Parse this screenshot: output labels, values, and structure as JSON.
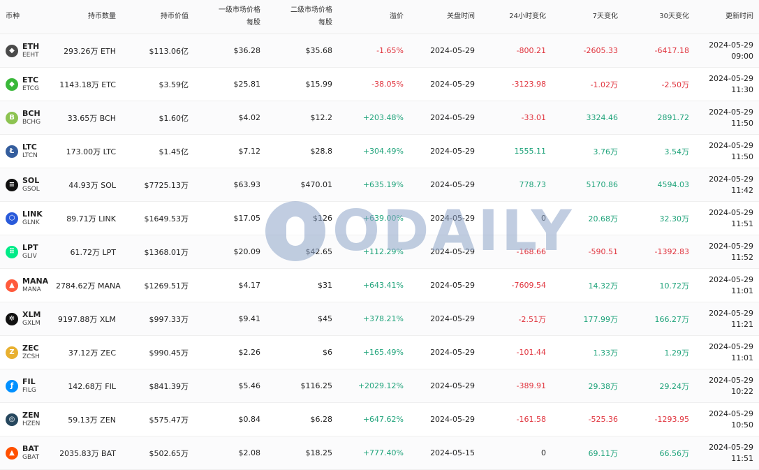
{
  "headers": {
    "coin": "币种",
    "holdings": "持币数量",
    "holdings_value": "持币价值",
    "primary_price_l1": "一级市场价格",
    "primary_price_l2": "每股",
    "secondary_price_l1": "二级市场价格",
    "secondary_price_l2": "每股",
    "premium": "溢价",
    "close_time": "关盘时间",
    "change_24h": "24小时变化",
    "change_7d": "7天变化",
    "change_30d": "30天变化",
    "updated": "更新时间"
  },
  "colors": {
    "positive": "#1fa37a",
    "negative": "#e0333d"
  },
  "watermark": "ODAILY",
  "rows": [
    {
      "symbol": "ETH",
      "fund": "EEHT",
      "icon": "ethereum-icon",
      "icon_glyph": "◆",
      "icon_color": "#4a4a4a",
      "holdings": "293.26万 ETH",
      "value": "$113.06亿",
      "primary": "$36.28",
      "secondary": "$35.68",
      "premium": "-1.65%",
      "premium_s": "neg",
      "close": "2024-05-29",
      "c24": "-800.21",
      "c24_s": "neg",
      "c7": "-2605.33",
      "c7_s": "neg",
      "c30": "-6417.18",
      "c30_s": "neg",
      "upd_date": "2024-05-29",
      "upd_time": "09:00"
    },
    {
      "symbol": "ETC",
      "fund": "ETCG",
      "icon": "ethereum-classic-icon",
      "icon_glyph": "◆",
      "icon_color": "#3ab83a",
      "holdings": "1143.18万 ETC",
      "value": "$3.59亿",
      "primary": "$25.81",
      "secondary": "$15.99",
      "premium": "-38.05%",
      "premium_s": "neg",
      "close": "2024-05-29",
      "c24": "-3123.98",
      "c24_s": "neg",
      "c7": "-1.02万",
      "c7_s": "neg",
      "c30": "-2.50万",
      "c30_s": "neg",
      "upd_date": "2024-05-29",
      "upd_time": "11:30"
    },
    {
      "symbol": "BCH",
      "fund": "BCHG",
      "icon": "bitcoin-cash-icon",
      "icon_glyph": "B",
      "icon_color": "#8dc351",
      "holdings": "33.65万 BCH",
      "value": "$1.60亿",
      "primary": "$4.02",
      "secondary": "$12.2",
      "premium": "+203.48%",
      "premium_s": "pos",
      "close": "2024-05-29",
      "c24": "-33.01",
      "c24_s": "neg",
      "c7": "3324.46",
      "c7_s": "pos",
      "c30": "2891.72",
      "c30_s": "pos",
      "upd_date": "2024-05-29",
      "upd_time": "11:50"
    },
    {
      "symbol": "LTC",
      "fund": "LTCN",
      "icon": "litecoin-icon",
      "icon_glyph": "Ł",
      "icon_color": "#345d9d",
      "holdings": "173.00万 LTC",
      "value": "$1.45亿",
      "primary": "$7.12",
      "secondary": "$28.8",
      "premium": "+304.49%",
      "premium_s": "pos",
      "close": "2024-05-29",
      "c24": "1555.11",
      "c24_s": "pos",
      "c7": "3.76万",
      "c7_s": "pos",
      "c30": "3.54万",
      "c30_s": "pos",
      "upd_date": "2024-05-29",
      "upd_time": "11:50"
    },
    {
      "symbol": "SOL",
      "fund": "GSOL",
      "icon": "solana-icon",
      "icon_glyph": "≡",
      "icon_color": "#111111",
      "holdings": "44.93万 SOL",
      "value": "$7725.13万",
      "primary": "$63.93",
      "secondary": "$470.01",
      "premium": "+635.19%",
      "premium_s": "pos",
      "close": "2024-05-29",
      "c24": "778.73",
      "c24_s": "pos",
      "c7": "5170.86",
      "c7_s": "pos",
      "c30": "4594.03",
      "c30_s": "pos",
      "upd_date": "2024-05-29",
      "upd_time": "11:42"
    },
    {
      "symbol": "LINK",
      "fund": "GLNK",
      "icon": "chainlink-icon",
      "icon_glyph": "⬡",
      "icon_color": "#2a5ada",
      "holdings": "89.71万 LINK",
      "value": "$1649.53万",
      "primary": "$17.05",
      "secondary": "$126",
      "premium": "+639.00%",
      "premium_s": "pos",
      "close": "2024-05-29",
      "c24": "0",
      "c24_s": "neu",
      "c7": "20.68万",
      "c7_s": "pos",
      "c30": "32.30万",
      "c30_s": "pos",
      "upd_date": "2024-05-29",
      "upd_time": "11:51"
    },
    {
      "symbol": "LPT",
      "fund": "GLIV",
      "icon": "livepeer-icon",
      "icon_glyph": "⠿",
      "icon_color": "#00eb88",
      "holdings": "61.72万 LPT",
      "value": "$1368.01万",
      "primary": "$20.09",
      "secondary": "$42.65",
      "premium": "+112.29%",
      "premium_s": "pos",
      "close": "2024-05-29",
      "c24": "-168.66",
      "c24_s": "neg",
      "c7": "-590.51",
      "c7_s": "neg",
      "c30": "-1392.83",
      "c30_s": "neg",
      "upd_date": "2024-05-29",
      "upd_time": "11:52"
    },
    {
      "symbol": "MANA",
      "fund": "MANA",
      "icon": "decentraland-icon",
      "icon_glyph": "▲",
      "icon_color": "#ff5a3c",
      "holdings": "2784.62万 MANA",
      "value": "$1269.51万",
      "primary": "$4.17",
      "secondary": "$31",
      "premium": "+643.41%",
      "premium_s": "pos",
      "close": "2024-05-29",
      "c24": "-7609.54",
      "c24_s": "neg",
      "c7": "14.32万",
      "c7_s": "pos",
      "c30": "10.72万",
      "c30_s": "pos",
      "upd_date": "2024-05-29",
      "upd_time": "11:01"
    },
    {
      "symbol": "XLM",
      "fund": "GXLM",
      "icon": "stellar-icon",
      "icon_glyph": "✲",
      "icon_color": "#111111",
      "holdings": "9197.88万 XLM",
      "value": "$997.33万",
      "primary": "$9.41",
      "secondary": "$45",
      "premium": "+378.21%",
      "premium_s": "pos",
      "close": "2024-05-29",
      "c24": "-2.51万",
      "c24_s": "neg",
      "c7": "177.99万",
      "c7_s": "pos",
      "c30": "166.27万",
      "c30_s": "pos",
      "upd_date": "2024-05-29",
      "upd_time": "11:21"
    },
    {
      "symbol": "ZEC",
      "fund": "ZCSH",
      "icon": "zcash-icon",
      "icon_glyph": "Z",
      "icon_color": "#e8b030",
      "holdings": "37.12万 ZEC",
      "value": "$990.45万",
      "primary": "$2.26",
      "secondary": "$6",
      "premium": "+165.49%",
      "premium_s": "pos",
      "close": "2024-05-29",
      "c24": "-101.44",
      "c24_s": "neg",
      "c7": "1.33万",
      "c7_s": "pos",
      "c30": "1.29万",
      "c30_s": "pos",
      "upd_date": "2024-05-29",
      "upd_time": "11:01"
    },
    {
      "symbol": "FIL",
      "fund": "FILG",
      "icon": "filecoin-icon",
      "icon_glyph": "ƒ",
      "icon_color": "#0090ff",
      "holdings": "142.68万 FIL",
      "value": "$841.39万",
      "primary": "$5.46",
      "secondary": "$116.25",
      "premium": "+2029.12%",
      "premium_s": "pos",
      "close": "2024-05-29",
      "c24": "-389.91",
      "c24_s": "neg",
      "c7": "29.38万",
      "c7_s": "pos",
      "c30": "29.24万",
      "c30_s": "pos",
      "upd_date": "2024-05-29",
      "upd_time": "10:22"
    },
    {
      "symbol": "ZEN",
      "fund": "HZEN",
      "icon": "horizen-icon",
      "icon_glyph": "◎",
      "icon_color": "#26475e",
      "holdings": "59.13万 ZEN",
      "value": "$575.47万",
      "primary": "$0.84",
      "secondary": "$6.28",
      "premium": "+647.62%",
      "premium_s": "pos",
      "close": "2024-05-29",
      "c24": "-161.58",
      "c24_s": "neg",
      "c7": "-525.36",
      "c7_s": "neg",
      "c30": "-1293.95",
      "c30_s": "neg",
      "upd_date": "2024-05-29",
      "upd_time": "10:50"
    },
    {
      "symbol": "BAT",
      "fund": "GBAT",
      "icon": "basic-attention-token-icon",
      "icon_glyph": "▲",
      "icon_color": "#ff5000",
      "holdings": "2035.83万 BAT",
      "value": "$502.65万",
      "primary": "$2.08",
      "secondary": "$18.25",
      "premium": "+777.40%",
      "premium_s": "pos",
      "close": "2024-05-15",
      "c24": "0",
      "c24_s": "neu",
      "c7": "69.11万",
      "c7_s": "pos",
      "c30": "66.56万",
      "c30_s": "pos",
      "upd_date": "2024-05-29",
      "upd_time": "11:51"
    }
  ]
}
